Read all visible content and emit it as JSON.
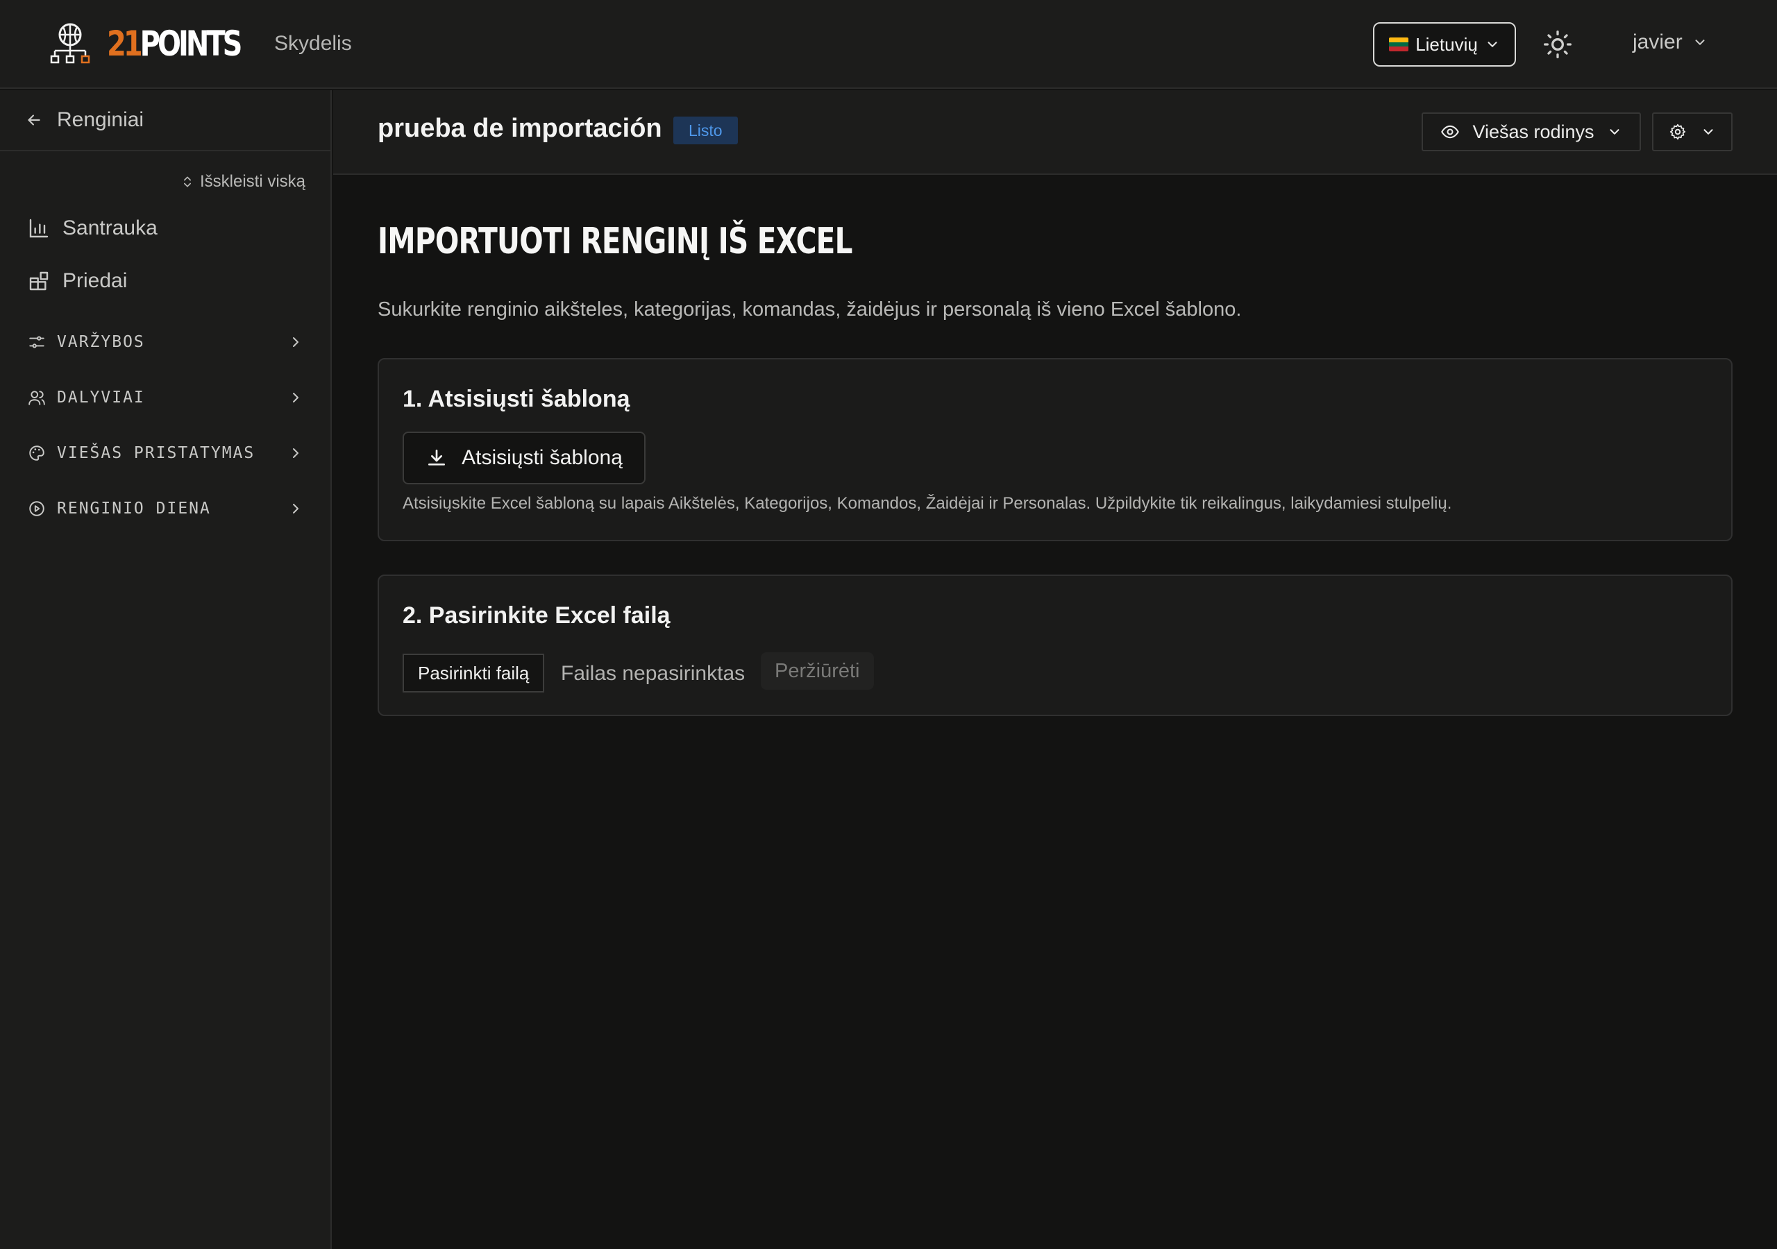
{
  "header": {
    "logo_number": "21",
    "logo_word": "POINTS",
    "nav_link": "Skydelis",
    "language": {
      "label": "Lietuvių",
      "flag_colors": [
        "#FDB913",
        "#006A44",
        "#C1272D"
      ]
    },
    "theme_icon": "sun-icon",
    "user": "javier"
  },
  "sidebar": {
    "back_label": "Renginiai",
    "expand_all": "Išskleisti viską",
    "items": [
      {
        "label": "Santrauka",
        "icon": "bar-chart-icon"
      },
      {
        "label": "Priedai",
        "icon": "blocks-icon"
      }
    ],
    "groups": [
      {
        "label": "VARŽYBOS",
        "icon": "sliders-icon"
      },
      {
        "label": "DALYVIAI",
        "icon": "users-icon"
      },
      {
        "label": "VIEŠAS PRISTATYMAS",
        "icon": "palette-icon"
      },
      {
        "label": "RENGINIO DIENA",
        "icon": "play-circle-icon"
      }
    ]
  },
  "page": {
    "title": "prueba de importación",
    "status": "Listo",
    "public_view": "Viešas rodinys",
    "heading": "IMPORTUOTI RENGINĮ IŠ EXCEL",
    "description": "Sukurkite renginio aikšteles, kategorijas, komandas, žaidėjus ir personalą iš vieno Excel šablono.",
    "step1": {
      "title": "1. Atsisiųsti šabloną",
      "button": "Atsisiųsti šabloną",
      "note": "Atsisiųskite Excel šabloną su lapais Aikštelės, Kategorijos, Komandos, Žaidėjai ir Personalas. Užpildykite tik reikalingus, laikydamiesi stulpelių."
    },
    "step2": {
      "title": "2. Pasirinkite Excel failą",
      "choose_button": "Pasirinkti failą",
      "no_file": "Failas nepasirinktas",
      "preview_button": "Peržiūrėti"
    }
  },
  "colors": {
    "accent_orange": "#E0701F",
    "badge_blue": "#4F98EA",
    "badge_bg": "#1D3556"
  }
}
